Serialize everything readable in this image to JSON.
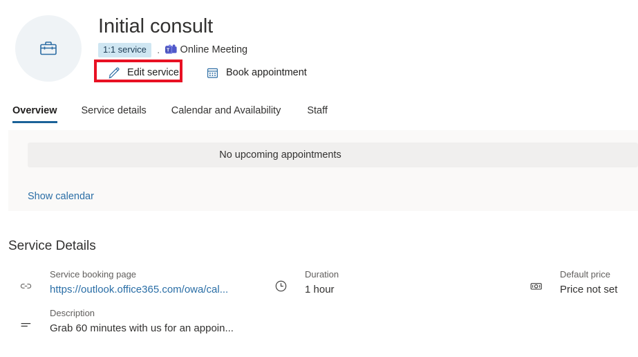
{
  "header": {
    "avatar_icon": "briefcase-icon",
    "title": "Initial consult",
    "badge": "1:1 service",
    "separator": "·",
    "meeting_icon": "microsoft-teams-icon",
    "meeting_type": "Online Meeting",
    "actions": [
      {
        "icon": "pencil-edit-icon",
        "label": "Edit service",
        "highlighted": true
      },
      {
        "icon": "calendar-icon",
        "label": "Book appointment",
        "highlighted": false
      }
    ],
    "highlight_color": "#e81123",
    "badge_color": "#cfe6f2",
    "accent_color": "#1b6298"
  },
  "tabs": [
    {
      "label": "Overview",
      "active": true
    },
    {
      "label": "Service details",
      "active": false
    },
    {
      "label": "Calendar and Availability",
      "active": false
    },
    {
      "label": "Staff",
      "active": false
    }
  ],
  "overview": {
    "empty_state": "No upcoming appointments",
    "show_calendar_link": "Show calendar"
  },
  "service_details": {
    "heading": "Service Details",
    "items": [
      {
        "icon": "link-icon",
        "label": "Service booking page",
        "value": "https://outlook.office365.com/owa/cal...",
        "is_link": true
      },
      {
        "icon": "clock-icon",
        "label": "Duration",
        "value": "1 hour",
        "is_link": false
      },
      {
        "icon": "money-icon",
        "label": "Default price",
        "value": "Price not set",
        "is_link": false
      },
      {
        "icon": "description-lines-icon",
        "label": "Description",
        "value": "Grab 60 minutes with us for an appoin...",
        "is_link": false
      }
    ]
  }
}
